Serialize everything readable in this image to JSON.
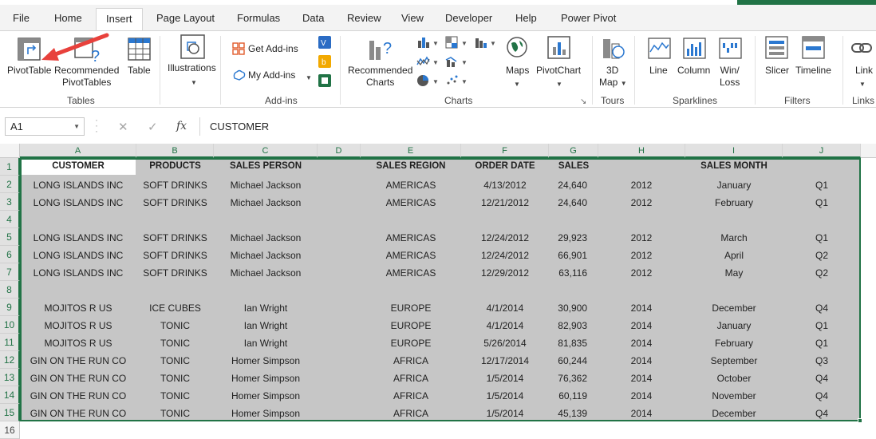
{
  "ribbon_tabs": [
    "File",
    "Home",
    "Insert",
    "Page Layout",
    "Formulas",
    "Data",
    "Review",
    "View",
    "Developer",
    "Help",
    "Power Pivot"
  ],
  "active_tab": "Insert",
  "ribbon": {
    "tables": {
      "pivottable": "PivotTable",
      "recommended_line1": "Recommended",
      "recommended_line2": "PivotTables",
      "table": "Table",
      "group": "Tables"
    },
    "illustrations": {
      "label": "Illustrations"
    },
    "addins": {
      "get": "Get Add-ins",
      "my": "My Add-ins",
      "group": "Add-ins"
    },
    "charts": {
      "recommended_line1": "Recommended",
      "recommended_line2": "Charts",
      "maps": "Maps",
      "pivotchart": "PivotChart",
      "group": "Charts"
    },
    "tours": {
      "map_line1": "3D",
      "map_line2": "Map",
      "group": "Tours"
    },
    "sparklines": {
      "line": "Line",
      "column": "Column",
      "winloss_line1": "Win/",
      "winloss_line2": "Loss",
      "group": "Sparklines"
    },
    "filters": {
      "slicer": "Slicer",
      "timeline": "Timeline",
      "group": "Filters"
    },
    "links": {
      "link": "Link",
      "group": "Links"
    }
  },
  "formula_bar": {
    "name_box": "A1",
    "formula": "CUSTOMER"
  },
  "colors": {
    "excel_green": "#217346",
    "arrow_red": "#e8413c",
    "selection_fill": "#c6c6c6"
  },
  "grid": {
    "columns": [
      "A",
      "B",
      "C",
      "D",
      "E",
      "F",
      "G",
      "H",
      "I",
      "J"
    ],
    "row_numbers": [
      "1",
      "2",
      "3",
      "4",
      "5",
      "6",
      "7",
      "8",
      "9",
      "10",
      "11",
      "12",
      "13",
      "14",
      "15",
      "16"
    ],
    "headers": {
      "customer": "CUSTOMER",
      "products": "PRODUCTS",
      "sales_person": "SALES PERSON",
      "sales_region": "SALES REGION",
      "order_date": "ORDER DATE",
      "sales": "SALES",
      "sales_month": "SALES MONTH"
    },
    "rows": [
      {
        "row": "2",
        "customer": "LONG ISLANDS INC",
        "product": "SOFT DRINKS",
        "person": "Michael Jackson",
        "region": "AMERICAS",
        "date": "4/13/2012",
        "sales": "24,640",
        "year": "2012",
        "month": "January",
        "quarter": "Q1"
      },
      {
        "row": "3",
        "customer": "LONG ISLANDS INC",
        "product": "SOFT DRINKS",
        "person": "Michael Jackson",
        "region": "AMERICAS",
        "date": "12/21/2012",
        "sales": "24,640",
        "year": "2012",
        "month": "February",
        "quarter": "Q1"
      },
      {
        "row": "5",
        "customer": "LONG ISLANDS INC",
        "product": "SOFT DRINKS",
        "person": "Michael Jackson",
        "region": "AMERICAS",
        "date": "12/24/2012",
        "sales": "29,923",
        "year": "2012",
        "month": "March",
        "quarter": "Q1"
      },
      {
        "row": "6",
        "customer": "LONG ISLANDS INC",
        "product": "SOFT DRINKS",
        "person": "Michael Jackson",
        "region": "AMERICAS",
        "date": "12/24/2012",
        "sales": "66,901",
        "year": "2012",
        "month": "April",
        "quarter": "Q2"
      },
      {
        "row": "7",
        "customer": "LONG ISLANDS INC",
        "product": "SOFT DRINKS",
        "person": "Michael Jackson",
        "region": "AMERICAS",
        "date": "12/29/2012",
        "sales": "63,116",
        "year": "2012",
        "month": "May",
        "quarter": "Q2"
      },
      {
        "row": "9",
        "customer": "MOJITOS R US",
        "product": "ICE CUBES",
        "person": "Ian Wright",
        "region": "EUROPE",
        "date": "4/1/2014",
        "sales": "30,900",
        "year": "2014",
        "month": "December",
        "quarter": "Q4"
      },
      {
        "row": "10",
        "customer": "MOJITOS R US",
        "product": "TONIC",
        "person": "Ian Wright",
        "region": "EUROPE",
        "date": "4/1/2014",
        "sales": "82,903",
        "year": "2014",
        "month": "January",
        "quarter": "Q1"
      },
      {
        "row": "11",
        "customer": "MOJITOS R US",
        "product": "TONIC",
        "person": "Ian Wright",
        "region": "EUROPE",
        "date": "5/26/2014",
        "sales": "81,835",
        "year": "2014",
        "month": "February",
        "quarter": "Q1"
      },
      {
        "row": "12",
        "customer": "GIN ON THE RUN CO",
        "product": "TONIC",
        "person": "Homer Simpson",
        "region": "AFRICA",
        "date": "12/17/2014",
        "sales": "60,244",
        "year": "2014",
        "month": "September",
        "quarter": "Q3"
      },
      {
        "row": "13",
        "customer": "GIN ON THE RUN CO",
        "product": "TONIC",
        "person": "Homer Simpson",
        "region": "AFRICA",
        "date": "1/5/2014",
        "sales": "76,362",
        "year": "2014",
        "month": "October",
        "quarter": "Q4"
      },
      {
        "row": "14",
        "customer": "GIN ON THE RUN CO",
        "product": "TONIC",
        "person": "Homer Simpson",
        "region": "AFRICA",
        "date": "1/5/2014",
        "sales": "60,119",
        "year": "2014",
        "month": "November",
        "quarter": "Q4"
      },
      {
        "row": "15",
        "customer": "GIN ON THE RUN CO",
        "product": "TONIC",
        "person": "Homer Simpson",
        "region": "AFRICA",
        "date": "1/5/2014",
        "sales": "45,139",
        "year": "2014",
        "month": "December",
        "quarter": "Q4"
      }
    ]
  }
}
